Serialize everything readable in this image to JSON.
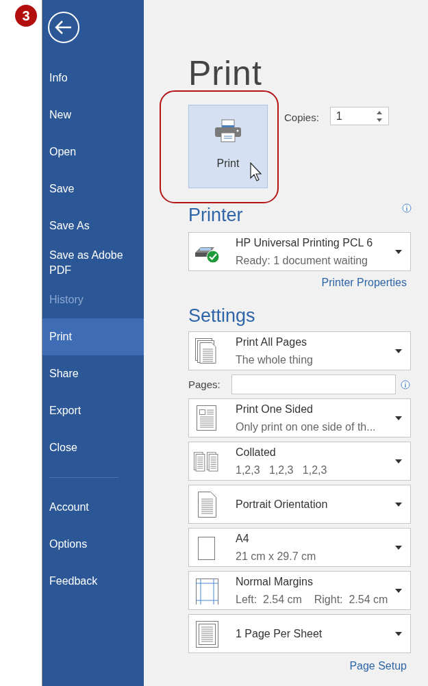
{
  "step_badge": "3",
  "sidebar": {
    "items": [
      {
        "label": "Info",
        "selected": false,
        "disabled": false
      },
      {
        "label": "New",
        "selected": false,
        "disabled": false
      },
      {
        "label": "Open",
        "selected": false,
        "disabled": false
      },
      {
        "label": "Save",
        "selected": false,
        "disabled": false
      },
      {
        "label": "Save As",
        "selected": false,
        "disabled": false
      },
      {
        "label": "Save as Adobe PDF",
        "selected": false,
        "disabled": false
      },
      {
        "label": "History",
        "selected": false,
        "disabled": true
      },
      {
        "label": "Print",
        "selected": true,
        "disabled": false
      },
      {
        "label": "Share",
        "selected": false,
        "disabled": false
      },
      {
        "label": "Export",
        "selected": false,
        "disabled": false
      },
      {
        "label": "Close",
        "selected": false,
        "disabled": false
      }
    ],
    "footer_items": [
      {
        "label": "Account",
        "selected": false,
        "disabled": false
      },
      {
        "label": "Options",
        "selected": false,
        "disabled": false
      },
      {
        "label": "Feedback",
        "selected": false,
        "disabled": false
      }
    ]
  },
  "page_title": "Print",
  "print_button": {
    "label": "Print",
    "highlighted": true
  },
  "copies": {
    "label": "Copies:",
    "value": "1"
  },
  "printer": {
    "heading": "Printer",
    "name": "HP Universal Printing PCL 6",
    "status": "Ready: 1 document waiting",
    "properties_link": "Printer Properties"
  },
  "settings": {
    "heading": "Settings",
    "options": [
      {
        "kind": "pages",
        "title": "Print All Pages",
        "subtitle": "The whole thing"
      },
      {
        "kind": "pages_field",
        "label": "Pages:"
      },
      {
        "kind": "sides",
        "title": "Print One Sided",
        "subtitle": "Only print on one side of th..."
      },
      {
        "kind": "collate",
        "title": "Collated",
        "subtitle": "1,2,3   1,2,3   1,2,3"
      },
      {
        "kind": "orientation",
        "title": "Portrait Orientation"
      },
      {
        "kind": "paper",
        "title": "A4",
        "subtitle": "21 cm x 29.7 cm"
      },
      {
        "kind": "margins",
        "title": "Normal Margins",
        "subtitle": "Left:  2.54 cm    Right:  2.54 cm"
      },
      {
        "kind": "per_sheet",
        "title": "1 Page Per Sheet"
      }
    ],
    "page_setup_link": "Page Setup"
  }
}
